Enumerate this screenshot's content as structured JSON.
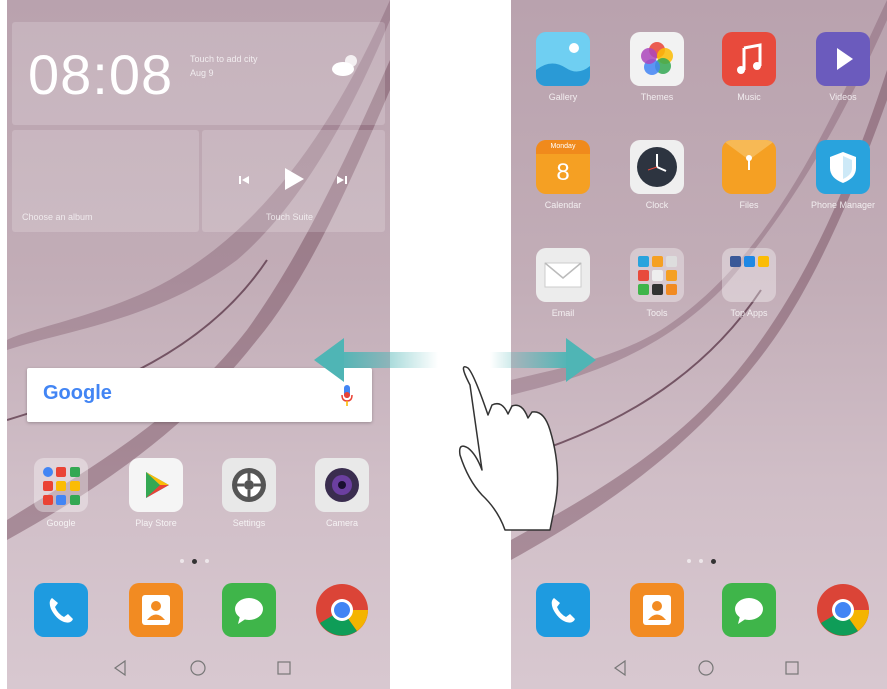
{
  "left_screen": {
    "clock_widget": {
      "time": "08:08",
      "city_hint": "Touch to add city",
      "date": "Aug 9",
      "weather_icon": "partly-cloudy-icon"
    },
    "album_widget": {
      "hint": "Choose an album"
    },
    "music_widget": {
      "hint": "Touch Suite",
      "icons": [
        "previous-icon",
        "play-icon",
        "next-icon"
      ]
    },
    "search": {
      "logo": "Google",
      "mic_icon": "mic-icon"
    },
    "apps": [
      {
        "name": "google-folder",
        "label": "Google"
      },
      {
        "name": "play-store",
        "label": "Play Store"
      },
      {
        "name": "settings",
        "label": "Settings"
      },
      {
        "name": "camera",
        "label": "Camera"
      }
    ],
    "page_dots": {
      "count": 3,
      "active_index": 1
    }
  },
  "right_screen": {
    "apps": [
      {
        "name": "gallery",
        "label": "Gallery"
      },
      {
        "name": "themes",
        "label": "Themes"
      },
      {
        "name": "music",
        "label": "Music"
      },
      {
        "name": "videos",
        "label": "Videos"
      },
      {
        "name": "calendar",
        "label": "Calendar",
        "day_text": "Monday",
        "day_number": "8"
      },
      {
        "name": "clock",
        "label": "Clock"
      },
      {
        "name": "files",
        "label": "Files"
      },
      {
        "name": "phone-manager",
        "label": "Phone Manager"
      },
      {
        "name": "email",
        "label": "Email"
      },
      {
        "name": "tools",
        "label": "Tools"
      },
      {
        "name": "top-apps",
        "label": "Top Apps"
      }
    ],
    "page_dots": {
      "count": 3,
      "active_index": 2
    }
  },
  "dock": [
    {
      "name": "phone",
      "icon": "phone-icon"
    },
    {
      "name": "contacts",
      "icon": "contacts-icon"
    },
    {
      "name": "messaging",
      "icon": "message-icon"
    },
    {
      "name": "chrome",
      "icon": "chrome-icon"
    }
  ],
  "navbar": [
    "back-icon",
    "home-icon",
    "recents-icon"
  ],
  "colors": {
    "phone": "#1e9be0",
    "contacts": "#f28b22",
    "messaging": "#3fb54a",
    "arrow": "#4fb5b5"
  }
}
